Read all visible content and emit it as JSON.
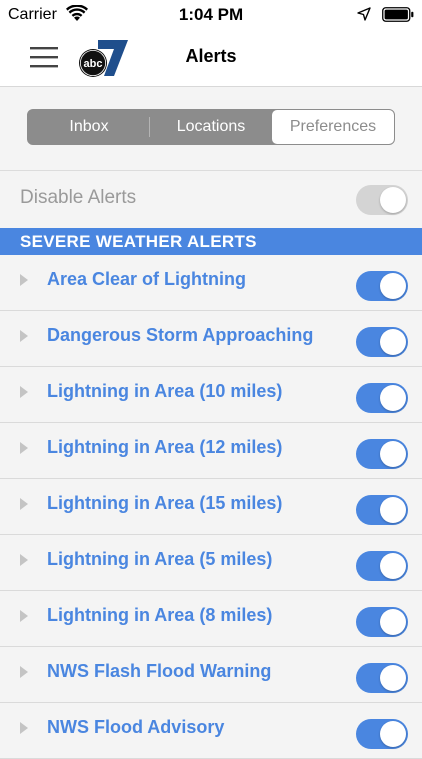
{
  "status_bar": {
    "carrier": "Carrier",
    "time": "1:04 PM",
    "wifi_icon": "wifi-icon",
    "location_icon": "location-arrow-icon",
    "battery_icon": "battery-icon"
  },
  "nav": {
    "title": "Alerts",
    "menu_icon": "hamburger-menu-icon",
    "logo": "abc7-logo"
  },
  "segments": [
    {
      "label": "Inbox",
      "selected": false
    },
    {
      "label": "Locations",
      "selected": false
    },
    {
      "label": "Preferences",
      "selected": true
    }
  ],
  "disable_alerts": {
    "label": "Disable Alerts",
    "enabled": false
  },
  "section": {
    "title": "SEVERE WEATHER ALERTS"
  },
  "alerts": [
    {
      "label": "Area Clear of Lightning",
      "on": true
    },
    {
      "label": "Dangerous Storm Approaching",
      "on": true
    },
    {
      "label": "Lightning in Area (10 miles)",
      "on": true
    },
    {
      "label": "Lightning in Area (12 miles)",
      "on": true
    },
    {
      "label": "Lightning in Area (15 miles)",
      "on": true
    },
    {
      "label": "Lightning in Area (5 miles)",
      "on": true
    },
    {
      "label": "Lightning in Area (8 miles)",
      "on": true
    },
    {
      "label": "NWS Flash Flood Warning",
      "on": true
    },
    {
      "label": "NWS Flood Advisory",
      "on": true
    }
  ],
  "colors": {
    "accent": "#4a86e0",
    "segment_bg": "#8c8c8c",
    "page_bg": "#f4f4f4",
    "disabled_text": "#9a9a9a",
    "disabled_toggle": "#d4d4d4"
  }
}
